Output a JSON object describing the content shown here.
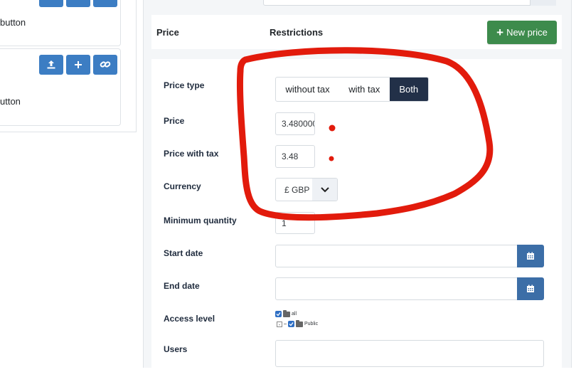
{
  "left": {
    "card1_text": "button",
    "card2_text": "utton"
  },
  "header": {
    "price_tab": "Price",
    "restrictions_tab": "Restrictions",
    "new_price_label": "New price"
  },
  "form": {
    "price_type_label": "Price type",
    "price_type_options": [
      "without tax",
      "with tax",
      "Both"
    ],
    "price_type_selected": "Both",
    "price_label": "Price",
    "price_value": "3.480000",
    "price_with_tax_label": "Price with tax",
    "price_with_tax_value": "3.48",
    "currency_label": "Currency",
    "currency_value": "£ GBP",
    "min_qty_label": "Minimum quantity",
    "min_qty_value": "1",
    "start_date_label": "Start date",
    "end_date_label": "End date",
    "access_level_label": "Access level",
    "access_tree": [
      "all",
      "Public"
    ],
    "users_label": "Users"
  },
  "annotation": {
    "color": "#e21b0c"
  },
  "colors": {
    "new_price": "#3d8b4c",
    "segment_active": "#223048",
    "action_blue": "#3c7dc3"
  },
  "icons": [
    "upload-icon",
    "plus-icon",
    "link-icon",
    "chevron-down-icon",
    "calendar-icon",
    "folder-icon",
    "checkbox-icon"
  ]
}
